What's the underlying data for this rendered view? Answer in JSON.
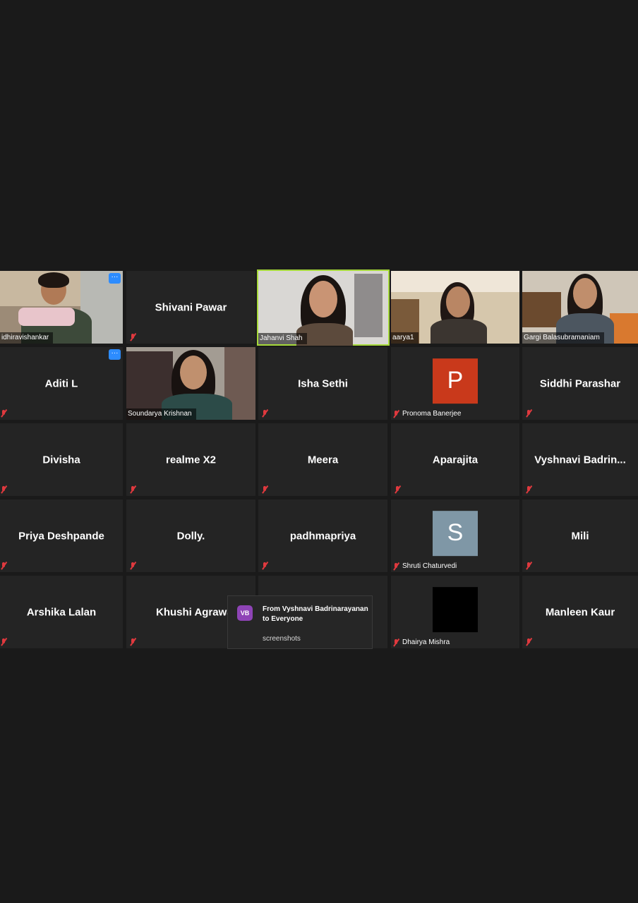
{
  "colors": {
    "background": "#1a1a1a",
    "tile": "#242424",
    "active_speaker": "#a6d93a",
    "muted": "#e0393e",
    "more_button": "#2d8cff"
  },
  "tiles": [
    {
      "name": "idhiravishankar",
      "mode": "video",
      "muted": false,
      "more": true
    },
    {
      "name": "Shivani Pawar",
      "mode": "name",
      "muted": true
    },
    {
      "name": "Jahanvi Shah",
      "mode": "video",
      "muted": false,
      "active": true
    },
    {
      "name": "aarya1",
      "mode": "video",
      "muted": false
    },
    {
      "name": "Gargi Balasubramaniam",
      "mode": "video",
      "muted": false
    },
    {
      "name": "Aditi L",
      "mode": "name",
      "muted": true,
      "more": true
    },
    {
      "name": "Soundarya Krishnan",
      "mode": "video",
      "muted": false
    },
    {
      "name": "Isha Sethi",
      "mode": "name",
      "muted": true
    },
    {
      "name": "Pronoma Banerjee",
      "mode": "avatar",
      "avatar_letter": "P",
      "avatar_color": "#c9391b",
      "muted": true
    },
    {
      "name": "Siddhi Parashar",
      "mode": "name",
      "muted": true
    },
    {
      "name": "Divisha",
      "mode": "name",
      "muted": true
    },
    {
      "name": "realme X2",
      "mode": "name",
      "muted": true
    },
    {
      "name": "Meera",
      "mode": "name",
      "muted": true
    },
    {
      "name": "Aparajita",
      "mode": "name",
      "muted": true
    },
    {
      "name": "Vyshnavi  Badrin...",
      "mode": "name",
      "muted": true
    },
    {
      "name": "Priya Deshpande",
      "mode": "name",
      "muted": true
    },
    {
      "name": "Dolly.",
      "mode": "name",
      "muted": true
    },
    {
      "name": "padhmapriya",
      "mode": "name",
      "muted": true
    },
    {
      "name": "Shruti Chaturvedi",
      "mode": "avatar",
      "avatar_letter": "S",
      "avatar_color": "#7f97a6",
      "muted": true
    },
    {
      "name": "Mili",
      "mode": "name",
      "muted": true
    },
    {
      "name": "Arshika Lalan",
      "mode": "name",
      "muted": true
    },
    {
      "name": "Khushi Agrawa",
      "mode": "name",
      "muted": true
    },
    {
      "name": "",
      "mode": "name",
      "muted": false
    },
    {
      "name": "Dhairya Mishra",
      "mode": "avatar",
      "avatar_letter": "",
      "avatar_color": "#000000",
      "muted": true
    },
    {
      "name": "Manleen Kaur",
      "mode": "name",
      "muted": true
    }
  ],
  "chat_popup": {
    "avatar_initials": "VB",
    "from": "From Vyshnavi Badrinarayanan to Everyone",
    "message": "screenshots"
  },
  "more_label": "···"
}
